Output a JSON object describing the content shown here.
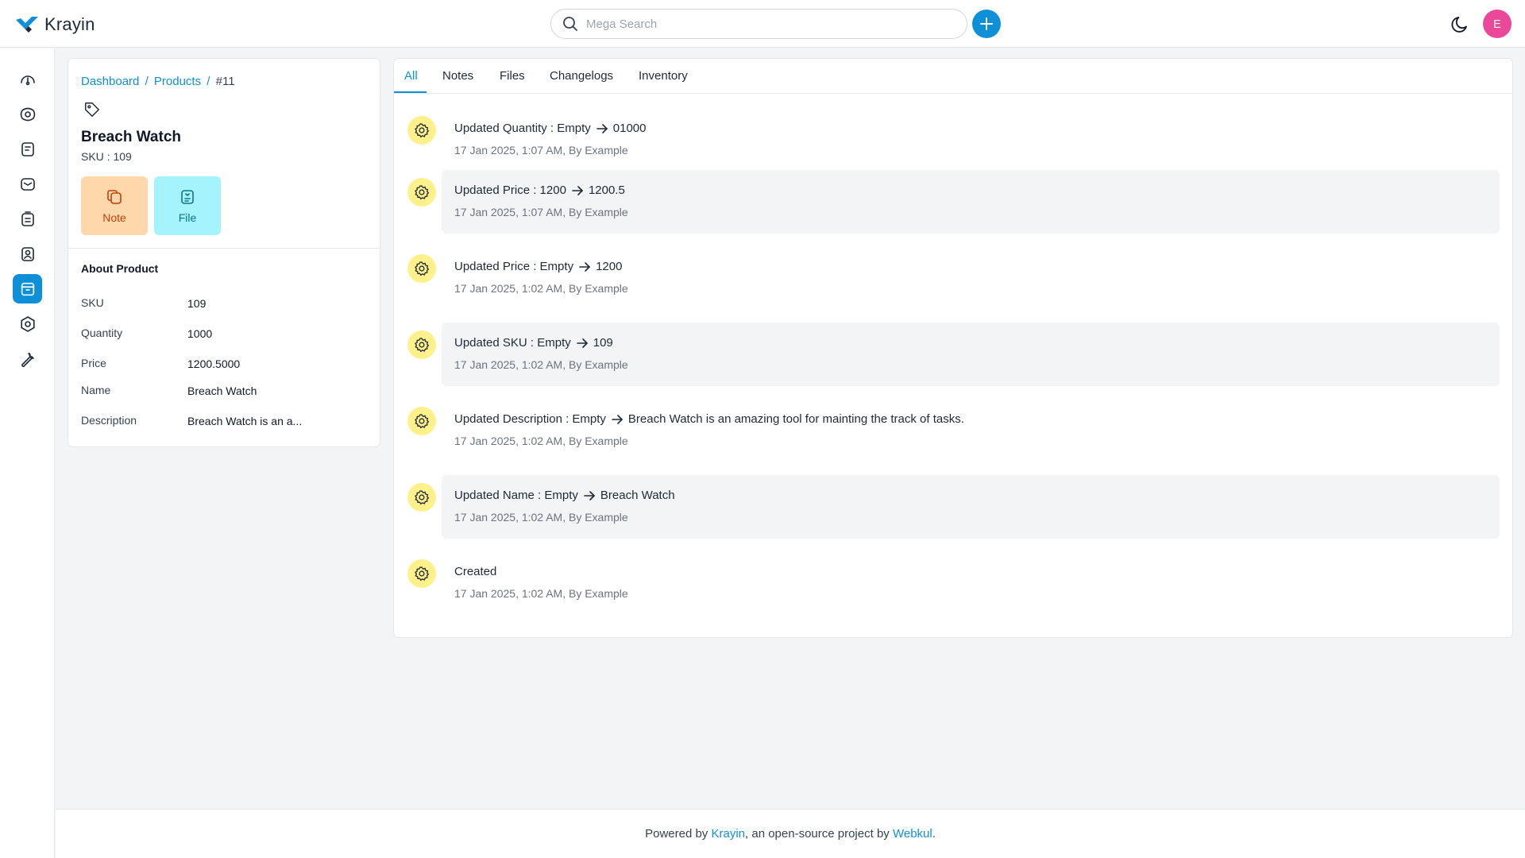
{
  "app": {
    "name": "Krayin"
  },
  "search": {
    "placeholder": "Mega Search"
  },
  "user": {
    "initial": "E"
  },
  "colors": {
    "accent": "#0e90d9",
    "avatar": "#ec4899",
    "note_bg": "#fed7aa",
    "file_bg": "#a5f3fc",
    "activity_icon_bg": "#fef08a"
  },
  "sidebar": {
    "items": [
      {
        "icon": "dashboard-icon"
      },
      {
        "icon": "leads-icon"
      },
      {
        "icon": "quotes-icon"
      },
      {
        "icon": "mail-icon"
      },
      {
        "icon": "activities-icon"
      },
      {
        "icon": "contacts-icon"
      },
      {
        "icon": "products-icon",
        "active": true
      },
      {
        "icon": "settings-icon"
      },
      {
        "icon": "configuration-icon"
      }
    ]
  },
  "breadcrumb": {
    "dashboard": "Dashboard",
    "products": "Products",
    "sep": "/",
    "current": "#11"
  },
  "product": {
    "name": "Breach Watch",
    "sku_line": "SKU : 109",
    "note_label": "Note",
    "file_label": "File",
    "about_title": "About Product",
    "attributes": [
      {
        "label": "SKU",
        "value": "109"
      },
      {
        "label": "Quantity",
        "value": "1000"
      },
      {
        "label": "Price",
        "value": "1200.5000"
      },
      {
        "label": "Name",
        "value": "Breach Watch"
      },
      {
        "label": "Description",
        "value": "Breach Watch is an a..."
      }
    ]
  },
  "tabs": [
    {
      "label": "All",
      "active": true
    },
    {
      "label": "Notes"
    },
    {
      "label": "Files"
    },
    {
      "label": "Changelogs"
    },
    {
      "label": "Inventory"
    }
  ],
  "activities": [
    {
      "prefix": "Updated Quantity : Empty",
      "value": "01000",
      "meta": "17 Jan 2025, 1:07 AM, By Example"
    },
    {
      "prefix": "Updated Price : 1200",
      "value": "1200.5",
      "meta": "17 Jan 2025, 1:07 AM, By Example"
    },
    {
      "prefix": "Updated Price : Empty",
      "value": "1200",
      "meta": "17 Jan 2025, 1:02 AM, By Example"
    },
    {
      "prefix": "Updated SKU : Empty",
      "value": "109",
      "meta": "17 Jan 2025, 1:02 AM, By Example"
    },
    {
      "prefix": "Updated Description : Empty",
      "value": "Breach Watch is an amazing tool for mainting the track of tasks.",
      "meta": "17 Jan 2025, 1:02 AM, By Example"
    },
    {
      "prefix": "Updated Name : Empty",
      "value": "Breach Watch",
      "meta": "17 Jan 2025, 1:02 AM, By Example"
    },
    {
      "prefix": "Created",
      "value": "",
      "meta": "17 Jan 2025, 1:02 AM, By Example"
    }
  ],
  "footer": {
    "prefix": "Powered by",
    "krayin": "Krayin",
    "middle": ", an open-source project by",
    "webkul": "Webkul",
    "suffix": "."
  }
}
